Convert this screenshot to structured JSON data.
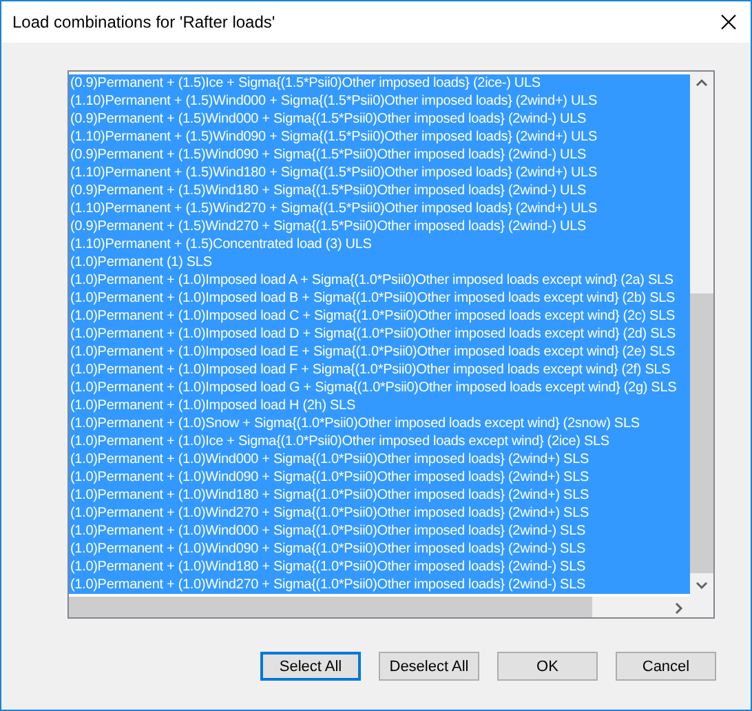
{
  "window": {
    "title": "Load combinations for 'Rafter loads'"
  },
  "combinations": [
    {
      "text": "(0.9)Permanent + (1.5)Ice + Sigma{(1.5*Psii0)Other imposed loads} (2ice-) ULS",
      "selected": true
    },
    {
      "text": "(1.10)Permanent + (1.5)Wind000 + Sigma{(1.5*Psii0)Other imposed loads} (2wind+) ULS",
      "selected": true
    },
    {
      "text": "(0.9)Permanent + (1.5)Wind000 + Sigma{(1.5*Psii0)Other imposed loads} (2wind-) ULS",
      "selected": true
    },
    {
      "text": "(1.10)Permanent + (1.5)Wind090 + Sigma{(1.5*Psii0)Other imposed loads} (2wind+) ULS",
      "selected": true
    },
    {
      "text": "(0.9)Permanent + (1.5)Wind090 + Sigma{(1.5*Psii0)Other imposed loads} (2wind-) ULS",
      "selected": true
    },
    {
      "text": "(1.10)Permanent + (1.5)Wind180 + Sigma{(1.5*Psii0)Other imposed loads} (2wind+) ULS",
      "selected": true
    },
    {
      "text": "(0.9)Permanent + (1.5)Wind180 + Sigma{(1.5*Psii0)Other imposed loads} (2wind-) ULS",
      "selected": true
    },
    {
      "text": "(1.10)Permanent + (1.5)Wind270 + Sigma{(1.5*Psii0)Other imposed loads} (2wind+) ULS",
      "selected": true
    },
    {
      "text": "(0.9)Permanent + (1.5)Wind270 + Sigma{(1.5*Psii0)Other imposed loads} (2wind-) ULS",
      "selected": true
    },
    {
      "text": "(1.10)Permanent + (1.5)Concentrated load (3) ULS",
      "selected": true
    },
    {
      "text": "(1.0)Permanent (1) SLS",
      "selected": true
    },
    {
      "text": "(1.0)Permanent + (1.0)Imposed load A + Sigma{(1.0*Psii0)Other imposed loads except wind} (2a) SLS",
      "selected": true
    },
    {
      "text": "(1.0)Permanent + (1.0)Imposed load B + Sigma{(1.0*Psii0)Other imposed loads except wind} (2b) SLS",
      "selected": true
    },
    {
      "text": "(1.0)Permanent + (1.0)Imposed load C + Sigma{(1.0*Psii0)Other imposed loads except wind} (2c) SLS",
      "selected": true
    },
    {
      "text": "(1.0)Permanent + (1.0)Imposed load D + Sigma{(1.0*Psii0)Other imposed loads except wind} (2d) SLS",
      "selected": true
    },
    {
      "text": "(1.0)Permanent + (1.0)Imposed load E + Sigma{(1.0*Psii0)Other imposed loads except wind} (2e) SLS",
      "selected": true
    },
    {
      "text": "(1.0)Permanent + (1.0)Imposed load F + Sigma{(1.0*Psii0)Other imposed loads except wind} (2f) SLS",
      "selected": true
    },
    {
      "text": "(1.0)Permanent + (1.0)Imposed load G + Sigma{(1.0*Psii0)Other imposed loads except wind} (2g) SLS",
      "selected": true
    },
    {
      "text": "(1.0)Permanent + (1.0)Imposed load H (2h) SLS",
      "selected": true
    },
    {
      "text": "(1.0)Permanent + (1.0)Snow + Sigma{(1.0*Psii0)Other imposed loads except wind} (2snow) SLS",
      "selected": true
    },
    {
      "text": "(1.0)Permanent + (1.0)Ice + Sigma{(1.0*Psii0)Other imposed loads except wind} (2ice) SLS",
      "selected": true
    },
    {
      "text": "(1.0)Permanent + (1.0)Wind000 + Sigma{(1.0*Psii0)Other imposed loads} (2wind+) SLS",
      "selected": true
    },
    {
      "text": "(1.0)Permanent + (1.0)Wind090 + Sigma{(1.0*Psii0)Other imposed loads} (2wind+) SLS",
      "selected": true
    },
    {
      "text": "(1.0)Permanent + (1.0)Wind180 + Sigma{(1.0*Psii0)Other imposed loads} (2wind+) SLS",
      "selected": true
    },
    {
      "text": "(1.0)Permanent + (1.0)Wind270 + Sigma{(1.0*Psii0)Other imposed loads} (2wind+) SLS",
      "selected": true
    },
    {
      "text": "(1.0)Permanent + (1.0)Wind000 + Sigma{(1.0*Psii0)Other imposed loads} (2wind-) SLS",
      "selected": true
    },
    {
      "text": "(1.0)Permanent + (1.0)Wind090 + Sigma{(1.0*Psii0)Other imposed loads} (2wind-) SLS",
      "selected": true
    },
    {
      "text": "(1.0)Permanent + (1.0)Wind180 + Sigma{(1.0*Psii0)Other imposed loads} (2wind-) SLS",
      "selected": true
    },
    {
      "text": "(1.0)Permanent + (1.0)Wind270 + Sigma{(1.0*Psii0)Other imposed loads} (2wind-) SLS",
      "selected": true
    }
  ],
  "buttons": [
    {
      "label": "Select All",
      "kind": "default"
    },
    {
      "label": "Deselect All",
      "kind": "normal"
    },
    {
      "label": "OK",
      "kind": "normal"
    },
    {
      "label": "Cancel",
      "kind": "normal"
    }
  ]
}
